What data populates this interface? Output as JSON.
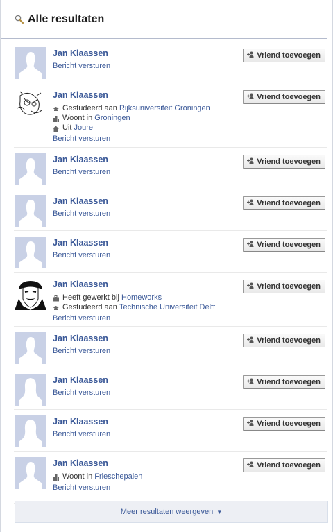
{
  "header": {
    "title": "Alle resultaten",
    "icon": "search-icon"
  },
  "add_friend_label": "Vriend toevoegen",
  "message_label": "Bericht versturen",
  "results": [
    {
      "name": "Jan Klaassen",
      "avatar": "silhouette-male",
      "details": []
    },
    {
      "name": "Jan Klaassen",
      "avatar": "sketch-photo",
      "details": [
        {
          "icon": "school-icon",
          "prefix": "Gestudeerd aan",
          "link": "Rijksuniversiteit Groningen"
        },
        {
          "icon": "city-icon",
          "prefix": "Woont in",
          "link": "Groningen"
        },
        {
          "icon": "home-icon",
          "prefix": "Uit",
          "link": "Joure"
        }
      ]
    },
    {
      "name": "Jan Klaassen",
      "avatar": "silhouette-male",
      "details": []
    },
    {
      "name": "Jan Klaassen",
      "avatar": "silhouette-male",
      "details": []
    },
    {
      "name": "Jan Klaassen",
      "avatar": "silhouette-male",
      "details": []
    },
    {
      "name": "Jan Klaassen",
      "avatar": "mask-photo",
      "details": [
        {
          "icon": "work-icon",
          "prefix": "Heeft gewerkt bij",
          "link": "Homeworks"
        },
        {
          "icon": "school-icon",
          "prefix": "Gestudeerd aan",
          "link": "Technische Universiteit Delft"
        }
      ]
    },
    {
      "name": "Jan Klaassen",
      "avatar": "silhouette-male",
      "details": []
    },
    {
      "name": "Jan Klaassen",
      "avatar": "silhouette-female",
      "details": []
    },
    {
      "name": "Jan Klaassen",
      "avatar": "silhouette-female",
      "details": []
    },
    {
      "name": "Jan Klaassen",
      "avatar": "silhouette-male",
      "details": [
        {
          "icon": "city-icon",
          "prefix": "Woont in",
          "link": "Frieschepalen"
        }
      ]
    }
  ],
  "more_results": {
    "label": "Meer resultaten weergeven",
    "icon": "caret-down-icon"
  },
  "colors": {
    "link": "#3b5998",
    "avatar_bg": "#c9d1e6",
    "more_bg": "#edeff4"
  }
}
